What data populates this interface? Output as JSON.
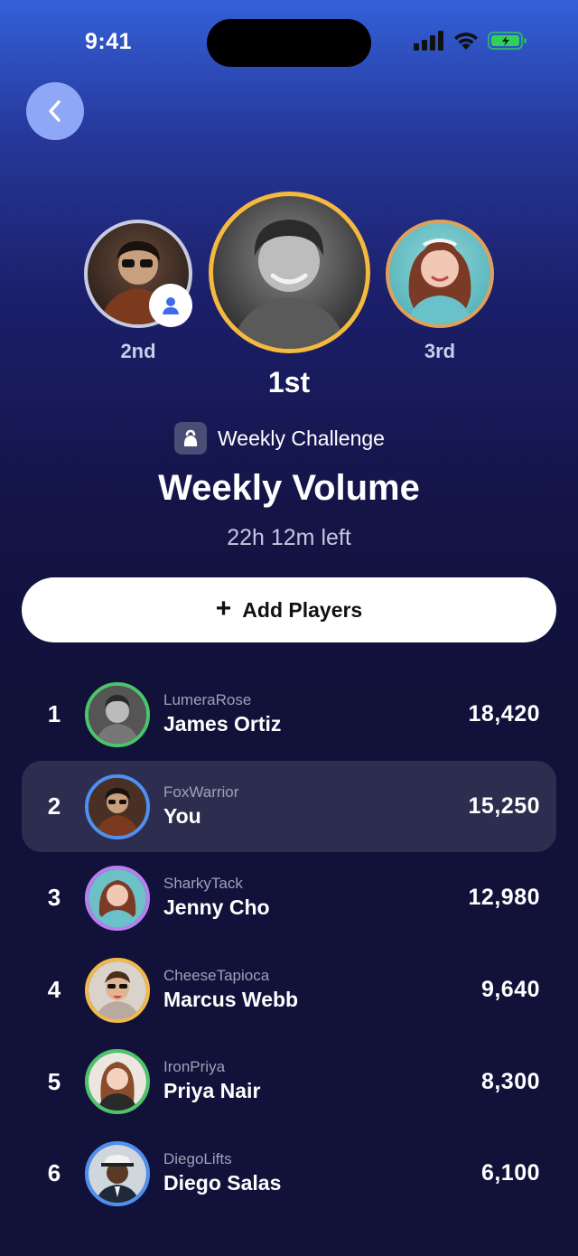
{
  "status": {
    "time": "9:41"
  },
  "podium": {
    "first": {
      "label": "1st",
      "ring_color": "#f5b93e"
    },
    "second": {
      "label": "2nd",
      "ring_color": "#c8cbdf"
    },
    "third": {
      "label": "3rd",
      "ring_color": "#e0a05a"
    }
  },
  "challenge": {
    "tag": "Weekly Challenge",
    "title": "Weekly Volume",
    "time_left": "22h 12m left"
  },
  "add_players": {
    "label": "Add Players"
  },
  "leaderboard": [
    {
      "rank": "1",
      "handle": "LumeraRose",
      "name": "James Ortiz",
      "score": "18,420",
      "ring": "#4cc46a",
      "avatar_icon": "person-avatar"
    },
    {
      "rank": "2",
      "handle": "FoxWarrior",
      "name": "You",
      "score": "15,250",
      "ring": "#4e8ff0",
      "avatar_icon": "person-avatar",
      "highlight": true
    },
    {
      "rank": "3",
      "handle": "SharkyTack",
      "name": "Jenny Cho",
      "score": "12,980",
      "ring": "#b77ff0",
      "avatar_icon": "person-avatar"
    },
    {
      "rank": "4",
      "handle": "CheeseTapioca",
      "name": "Marcus Webb",
      "score": "9,640",
      "ring": "#f1b94a",
      "avatar_icon": "person-avatar"
    },
    {
      "rank": "5",
      "handle": "IronPriya",
      "name": "Priya Nair",
      "score": "8,300",
      "ring": "#4cc46a",
      "avatar_icon": "person-avatar"
    },
    {
      "rank": "6",
      "handle": "DiegoLifts",
      "name": "Diego Salas",
      "score": "6,100",
      "ring": "#4e8ff0",
      "avatar_icon": "person-avatar"
    }
  ]
}
